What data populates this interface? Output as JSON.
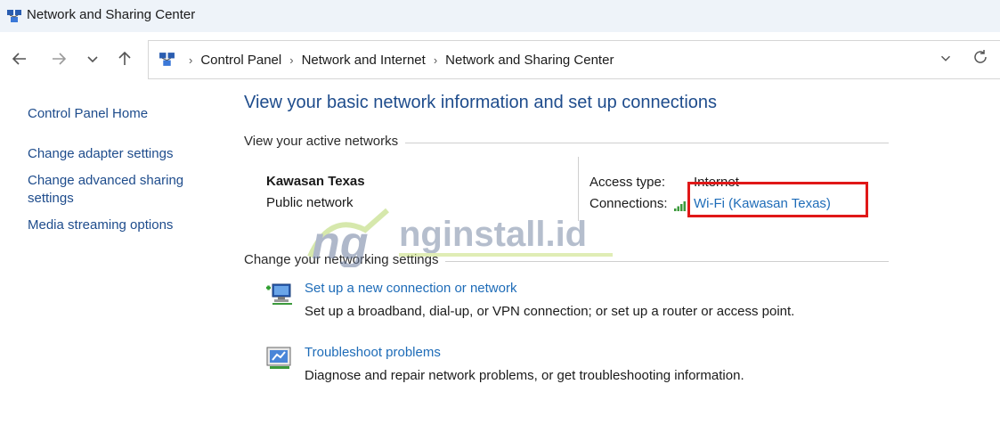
{
  "window": {
    "title": "Network and Sharing Center"
  },
  "nav": {
    "back_icon": "arrow-left-icon",
    "forward_icon": "arrow-right-icon",
    "recent_icon": "chevron-down-icon",
    "up_icon": "arrow-up-icon"
  },
  "address": {
    "crumbs": [
      "Control Panel",
      "Network and Internet",
      "Network and Sharing Center"
    ],
    "dropdown_icon": "chevron-down-icon",
    "refresh_icon": "refresh-icon"
  },
  "sidebar": {
    "home": "Control Panel Home",
    "items": [
      {
        "label": "Change adapter settings"
      },
      {
        "label": "Change advanced sharing settings"
      },
      {
        "label": "Media streaming options"
      }
    ]
  },
  "main": {
    "heading": "View your basic network information and set up connections",
    "active_networks_label": "View your active networks",
    "network": {
      "name": "Kawasan Texas",
      "category": "Public network",
      "access_type_label": "Access type:",
      "access_type_value": "Internet",
      "connections_label": "Connections:",
      "connection_value": "Wi-Fi (Kawasan Texas)"
    },
    "change_settings_label": "Change your networking settings",
    "tasks": [
      {
        "link": "Set up a new connection or network",
        "description": "Set up a broadband, dial-up, or VPN connection; or set up a router or access point."
      },
      {
        "link": "Troubleshoot problems",
        "description": "Diagnose and repair network problems, or get troubleshooting information."
      }
    ]
  },
  "watermark": {
    "text": "nginstall.id"
  },
  "colors": {
    "link": "#1e6cb8",
    "heading": "#1e4c8c",
    "highlight": "#e01818",
    "titlebar_bg": "#eef3f9"
  }
}
